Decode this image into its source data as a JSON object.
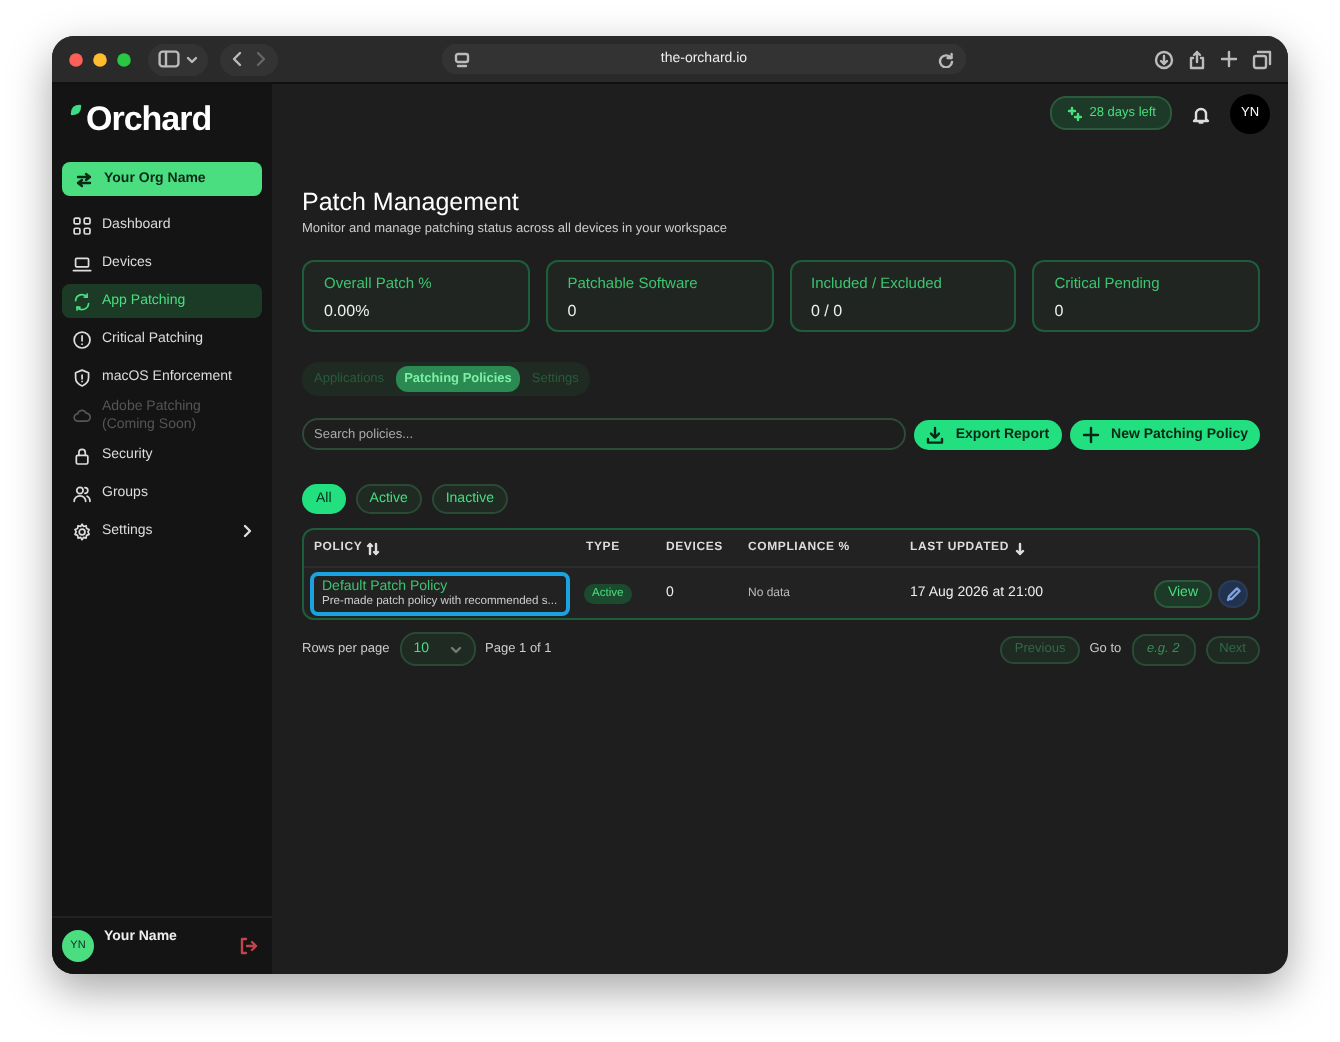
{
  "browser": {
    "url": "the-orchard.io"
  },
  "logo": "Orchard",
  "org_button": "Your Org Name",
  "nav": [
    {
      "label": "Dashboard",
      "selected": false,
      "disabled": false,
      "expandable": false
    },
    {
      "label": "Devices",
      "selected": false,
      "disabled": false,
      "expandable": false
    },
    {
      "label": "App Patching",
      "selected": true,
      "disabled": false,
      "expandable": false
    },
    {
      "label": "Critical Patching",
      "selected": false,
      "disabled": false,
      "expandable": false
    },
    {
      "label": "macOS Enforcement",
      "selected": false,
      "disabled": false,
      "expandable": false
    },
    {
      "label": "Adobe Patching (Coming Soon)",
      "selected": false,
      "disabled": true,
      "expandable": false
    },
    {
      "label": "Security",
      "selected": false,
      "disabled": false,
      "expandable": false
    },
    {
      "label": "Groups",
      "selected": false,
      "disabled": false,
      "expandable": false
    },
    {
      "label": "Settings",
      "selected": false,
      "disabled": false,
      "expandable": true
    }
  ],
  "user": {
    "initials": "YN",
    "name": "Your Name"
  },
  "topbar": {
    "trial": "28 days left",
    "avatar": "YN"
  },
  "page": {
    "title": "Patch Management",
    "subtitle": "Monitor and manage patching status across all devices in your workspace"
  },
  "stats": [
    {
      "label": "Overall Patch %",
      "value": "0.00%"
    },
    {
      "label": "Patchable Software",
      "value": "0"
    },
    {
      "label": "Included / Excluded",
      "value": "0 / 0"
    },
    {
      "label": "Critical Pending",
      "value": "0"
    }
  ],
  "tabs": [
    {
      "label": "Applications",
      "selected": false
    },
    {
      "label": "Patching Policies",
      "selected": true
    },
    {
      "label": "Settings",
      "selected": false
    }
  ],
  "search": {
    "placeholder": "Search policies..."
  },
  "actions": [
    "Export Report",
    "New Patching Policy"
  ],
  "filters": [
    {
      "label": "All",
      "selected": true
    },
    {
      "label": "Active",
      "selected": false
    },
    {
      "label": "Inactive",
      "selected": false
    }
  ],
  "table": {
    "columns": [
      {
        "label": "POLICY",
        "sortable": true,
        "sorted_descending": false
      },
      {
        "label": "TYPE",
        "sortable": false,
        "sorted_descending": false
      },
      {
        "label": "DEVICES",
        "sortable": false,
        "sorted_descending": false
      },
      {
        "label": "COMPLIANCE %",
        "sortable": false,
        "sorted_descending": false
      },
      {
        "label": "LAST UPDATED",
        "sortable": false,
        "sorted_descending": true
      }
    ],
    "rows": [
      {
        "name": "Default Patch Policy",
        "description": "Pre-made patch policy with recommended s...",
        "type": "Active",
        "devices": "0",
        "compliance": "No data",
        "last_updated": "17 Aug 2026 at 21:00",
        "action": "View",
        "selected": true
      }
    ]
  },
  "pagination": {
    "rows_label": "Rows per page",
    "rows_value": "10",
    "page": "Page 1 of 1",
    "previous": "Previous",
    "goto_label": "Go to",
    "goto_placeholder": "e.g. 2",
    "next": "Next",
    "previous_disabled": true,
    "next_disabled": true
  }
}
